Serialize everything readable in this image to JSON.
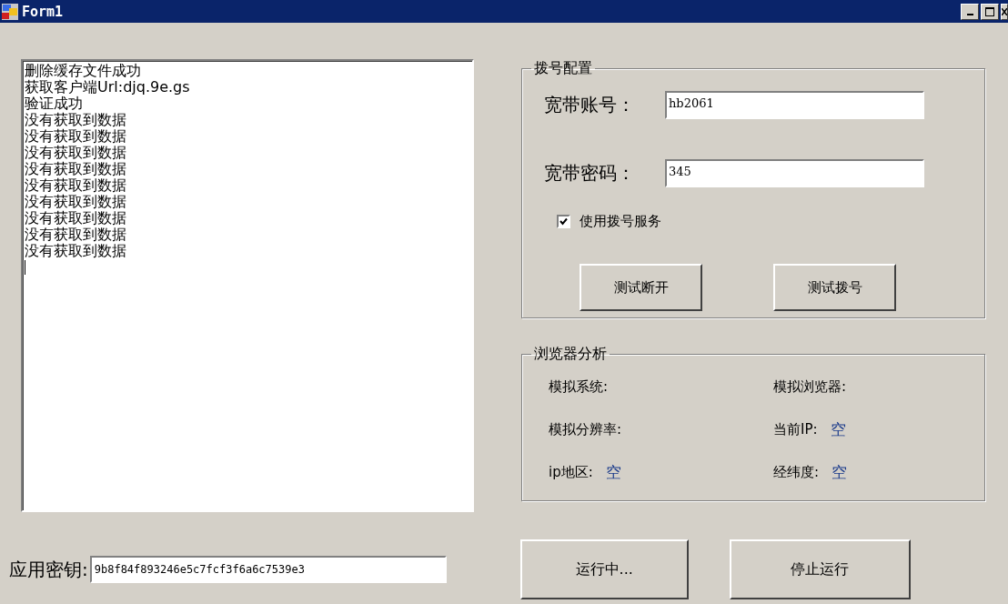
{
  "window": {
    "title": "Form1"
  },
  "log": {
    "lines": [
      "删除缓存文件成功",
      "获取客户端Url:djq.9e.gs",
      "验证成功",
      "没有获取到数据",
      "没有获取到数据",
      "没有获取到数据",
      "没有获取到数据",
      "没有获取到数据",
      "没有获取到数据",
      "没有获取到数据",
      "没有获取到数据",
      "没有获取到数据"
    ]
  },
  "dial_config": {
    "title": "拨号配置",
    "fields": [
      {
        "label": "宽带账号：",
        "value": "hb2061"
      },
      {
        "label": "宽带密码：",
        "value": "345"
      }
    ],
    "use_dial_service": {
      "label": "使用拨号服务",
      "checked": true
    },
    "buttons": [
      "测试断开",
      "测试拨号"
    ]
  },
  "browser_analysis": {
    "title": "浏览器分析",
    "items": [
      {
        "label": "模拟系统:"
      },
      {
        "label": "模拟浏览器:"
      },
      {
        "label": "模拟分辨率:"
      },
      {
        "label": "当前IP:",
        "value": "空"
      },
      {
        "label": "ip地区:",
        "value": "空"
      },
      {
        "label": "经纬度:",
        "value": "空"
      }
    ]
  },
  "app_key": {
    "label": "应用密钥:",
    "value": "9b8f84f893246e5c7fcf3f6a6c7539e3"
  },
  "buttons": [
    "运行中...",
    "停止运行"
  ]
}
